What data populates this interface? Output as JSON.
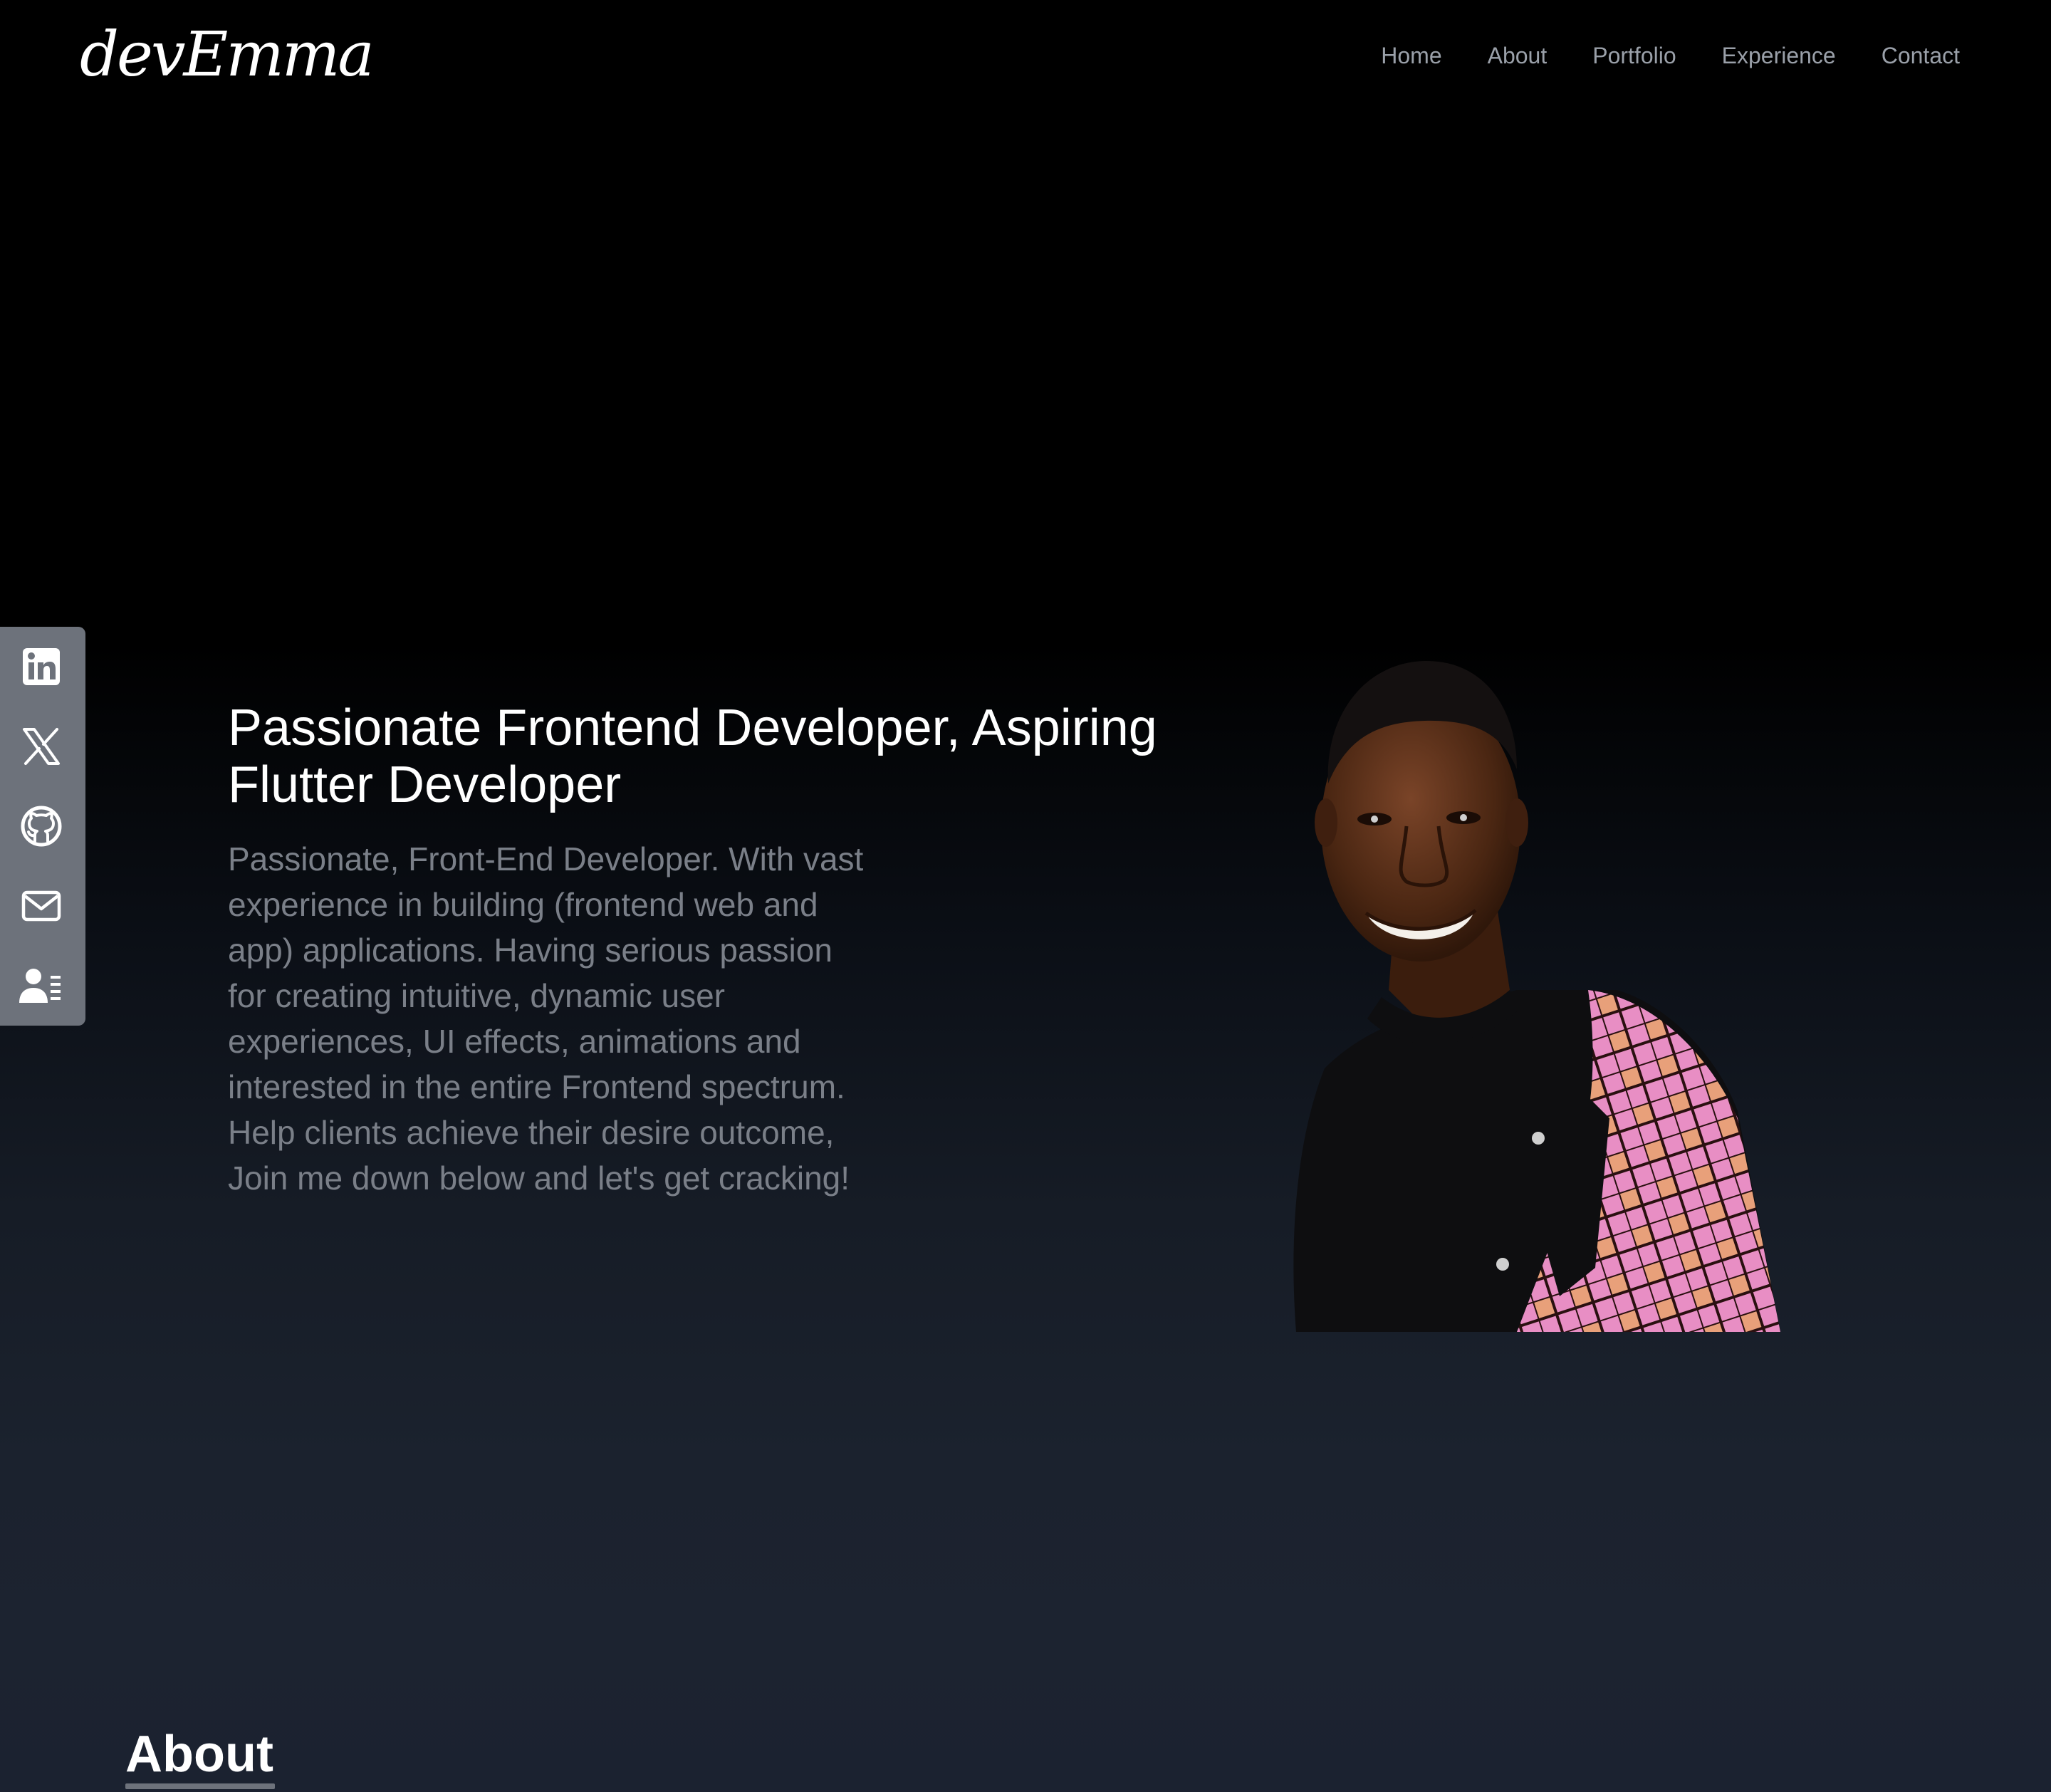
{
  "brand": {
    "logo_text": "devEmma"
  },
  "nav": {
    "items": [
      {
        "label": "Home"
      },
      {
        "label": "About"
      },
      {
        "label": "Portfolio"
      },
      {
        "label": "Experience"
      },
      {
        "label": "Contact"
      }
    ]
  },
  "social": {
    "icons": [
      "linkedin-icon",
      "x-twitter-icon",
      "github-icon",
      "mail-icon",
      "contact-card-icon"
    ]
  },
  "hero": {
    "title": "Passionate Frontend Developer, Aspiring Flutter Developer",
    "description": "Passionate, Front-End Developer. With vast experience in building (frontend web and app) applications. Having serious passion for creating intuitive, dynamic user experiences, UI effects, animations and interested in the entire Frontend spectrum. Help clients achieve their desire outcome, Join me down below and let's get cracking!"
  },
  "about": {
    "heading": "About"
  },
  "colors": {
    "background_top": "#000000",
    "background_bottom": "#1b2230",
    "nav_text": "#9aa0a9",
    "body_text": "#7a7f88",
    "social_bar": "#6d727b",
    "heading_text": "#ffffff"
  }
}
